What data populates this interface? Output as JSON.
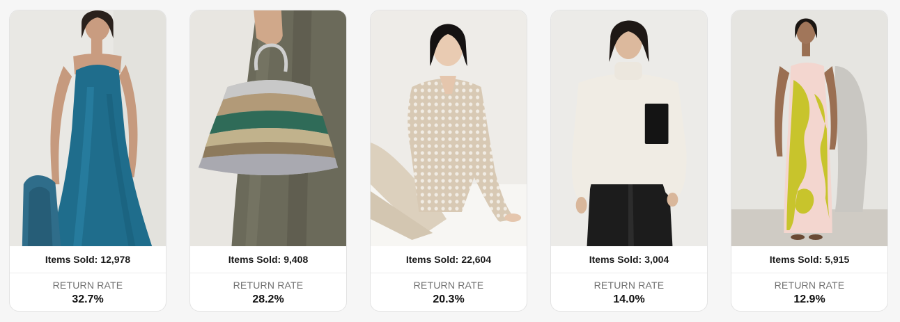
{
  "products": [
    {
      "image_icon": "product-photo-blue-satin-slip-dress",
      "items_sold_label": "Items Sold:",
      "items_sold_value": "12,978",
      "return_rate_label": "RETURN RATE",
      "return_rate_value": "32.7%"
    },
    {
      "image_icon": "product-photo-striped-sequin-pouch-bag",
      "items_sold_label": "Items Sold:",
      "items_sold_value": "9,408",
      "return_rate_label": "RETURN RATE",
      "return_rate_value": "28.2%"
    },
    {
      "image_icon": "product-photo-beige-open-knit-sweater",
      "items_sold_label": "Items Sold:",
      "items_sold_value": "22,604",
      "return_rate_label": "RETURN RATE",
      "return_rate_value": "20.3%"
    },
    {
      "image_icon": "product-photo-cream-turtleneck-sweater",
      "items_sold_label": "Items Sold:",
      "items_sold_value": "3,004",
      "return_rate_label": "RETURN RATE",
      "return_rate_value": "14.0%"
    },
    {
      "image_icon": "product-photo-pink-yellow-floral-slip-dress",
      "items_sold_label": "Items Sold:",
      "items_sold_value": "5,915",
      "return_rate_label": "RETURN RATE",
      "return_rate_value": "12.9%"
    }
  ],
  "colors": {
    "page_background": "#f6f6f6",
    "card_background": "#ffffff",
    "label_gray": "#707070",
    "text_dark": "#111111"
  }
}
